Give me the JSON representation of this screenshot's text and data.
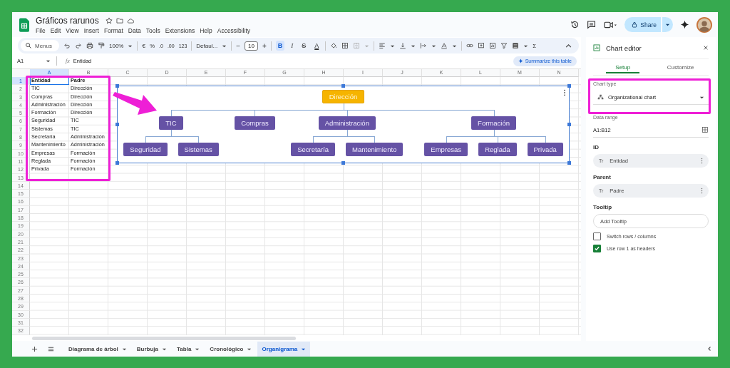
{
  "document": {
    "title": "Gráficos rarunos"
  },
  "menu": [
    "File",
    "Edit",
    "View",
    "Insert",
    "Format",
    "Data",
    "Tools",
    "Extensions",
    "Help",
    "Accessibility"
  ],
  "header": {
    "share_label": "Share"
  },
  "toolbar": {
    "search_label": "Menus",
    "zoom": "100%",
    "currency": "€",
    "percent": "%",
    "decrease_decimals": ".0",
    "increase_decimals": ".00",
    "number_format": "123",
    "font": "Defaul...",
    "font_minus": "−",
    "font_size": "10",
    "font_plus": "+",
    "bold": {
      "label": "B",
      "on": true
    },
    "italic": "I",
    "strikethrough": "S",
    "text_color": "A",
    "functions": "Σ"
  },
  "formula_bar": {
    "cell_ref": "A1",
    "fx": "fx",
    "content": "Entidad"
  },
  "summarize_button": "Summarize this table",
  "sheet": {
    "columns": [
      {
        "label": "A",
        "selected": true
      },
      {
        "label": "B",
        "selected": false
      },
      {
        "label": "C",
        "selected": false
      },
      {
        "label": "D",
        "selected": false
      },
      {
        "label": "E",
        "selected": false
      },
      {
        "label": "F",
        "selected": false
      },
      {
        "label": "G",
        "selected": false
      },
      {
        "label": "H",
        "selected": false
      },
      {
        "label": "I",
        "selected": false
      },
      {
        "label": "J",
        "selected": false
      },
      {
        "label": "K",
        "selected": false
      },
      {
        "label": "L",
        "selected": false
      },
      {
        "label": "M",
        "selected": false
      },
      {
        "label": "N",
        "selected": false
      }
    ],
    "rows": [
      {
        "number": "1",
        "selected": true,
        "cells": [
          "Entidad",
          "Padre"
        ]
      },
      {
        "number": "2",
        "selected": false,
        "cells": [
          "TIC",
          "Dirección"
        ]
      },
      {
        "number": "3",
        "selected": false,
        "cells": [
          "Compras",
          "Dirección"
        ]
      },
      {
        "number": "4",
        "selected": false,
        "cells": [
          "Administración",
          "Dirección"
        ]
      },
      {
        "number": "5",
        "selected": false,
        "cells": [
          "Formación",
          "Dirección"
        ]
      },
      {
        "number": "6",
        "selected": false,
        "cells": [
          "Seguridad",
          "TIC"
        ]
      },
      {
        "number": "7",
        "selected": false,
        "cells": [
          "Sistemas",
          "TIC"
        ]
      },
      {
        "number": "8",
        "selected": false,
        "cells": [
          "Secretaría",
          "Administración"
        ]
      },
      {
        "number": "9",
        "selected": false,
        "cells": [
          "Mantenimiento",
          "Administración"
        ]
      },
      {
        "number": "10",
        "selected": false,
        "cells": [
          "Empresas",
          "Formación"
        ]
      },
      {
        "number": "11",
        "selected": false,
        "cells": [
          "Reglada",
          "Formación"
        ]
      },
      {
        "number": "12",
        "selected": false,
        "cells": [
          "Privada",
          "Formación"
        ]
      },
      {
        "number": "13",
        "selected": false
      },
      {
        "number": "14",
        "selected": false
      },
      {
        "number": "15",
        "selected": false
      },
      {
        "number": "16",
        "selected": false
      },
      {
        "number": "17",
        "selected": false
      },
      {
        "number": "18",
        "selected": false
      },
      {
        "number": "19",
        "selected": false
      },
      {
        "number": "20",
        "selected": false
      },
      {
        "number": "21",
        "selected": false
      },
      {
        "number": "22",
        "selected": false
      },
      {
        "number": "23",
        "selected": false
      },
      {
        "number": "24",
        "selected": false
      },
      {
        "number": "25",
        "selected": false
      },
      {
        "number": "26",
        "selected": false
      },
      {
        "number": "27",
        "selected": false
      },
      {
        "number": "28",
        "selected": false
      },
      {
        "number": "29",
        "selected": false
      },
      {
        "number": "30",
        "selected": false
      },
      {
        "number": "31",
        "selected": false
      },
      {
        "number": "32",
        "selected": false
      }
    ]
  },
  "chart": {
    "org_chart": {
      "label": "Dirección",
      "selected": true,
      "children": [
        {
          "label": "TIC",
          "selected": false,
          "children": [
            {
              "label": "Seguridad",
              "selected": false
            },
            {
              "label": "Sistemas",
              "selected": false
            }
          ]
        },
        {
          "label": "Compras",
          "selected": false
        },
        {
          "label": "Administración",
          "selected": false,
          "children": [
            {
              "label": "Secretaría",
              "selected": false
            },
            {
              "label": "Mantenimiento",
              "selected": false
            }
          ]
        },
        {
          "label": "Formación",
          "selected": false,
          "children": [
            {
              "label": "Empresas",
              "selected": false
            },
            {
              "label": "Reglada",
              "selected": false
            },
            {
              "label": "Privada",
              "selected": false
            }
          ]
        }
      ]
    }
  },
  "editor": {
    "title": "Chart editor",
    "tabs": [
      {
        "label": "Setup",
        "selected": true
      },
      {
        "label": "Customize",
        "selected": false
      }
    ],
    "chart_type_label": "Chart type",
    "chart_type": "Organizational chart",
    "data_range_label": "Data range",
    "data_range": "A1:B12",
    "fields": [
      {
        "label": "ID",
        "type_icon": "Tr",
        "value": "Entidad"
      },
      {
        "label": "Parent",
        "type_icon": "Tr",
        "value": "Padre"
      }
    ],
    "tooltip": {
      "label": "Tooltip",
      "placeholder": "Add Tooltip"
    },
    "options": [
      {
        "label": "Switch rows / columns",
        "checked": false
      },
      {
        "label": "Use row 1 as headers",
        "checked": true
      }
    ]
  },
  "sheet_tabs": [
    {
      "label": "Diagrama de árbol",
      "selected": false
    },
    {
      "label": "Burbuja",
      "selected": false
    },
    {
      "label": "Tabla",
      "selected": false
    },
    {
      "label": "Cronológico",
      "selected": false
    },
    {
      "label": "Organigrama",
      "selected": true
    }
  ]
}
